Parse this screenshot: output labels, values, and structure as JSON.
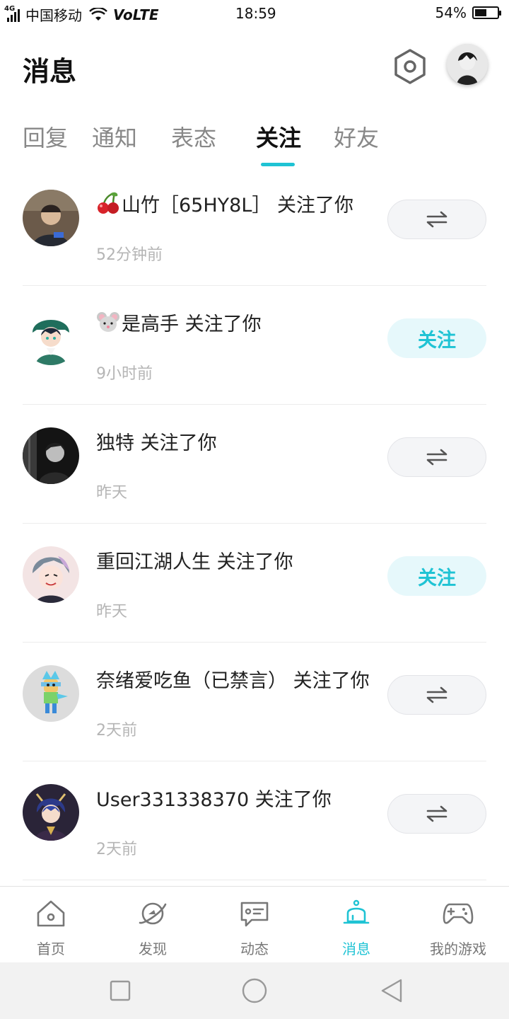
{
  "status_bar": {
    "network": "4G",
    "carrier": "中国移动",
    "volte": "VoLTE",
    "time": "18:59",
    "battery_text": "54%",
    "battery_level": 0.54
  },
  "header": {
    "title": "消息"
  },
  "tabs": [
    {
      "label": "回复",
      "active": false
    },
    {
      "label": "通知",
      "active": false
    },
    {
      "label": "表态",
      "active": false
    },
    {
      "label": "关注",
      "active": true
    },
    {
      "label": "好友",
      "active": false
    }
  ],
  "notifications": [
    {
      "emoji": "cherry-icon",
      "name": "山竹［65HY8L］ 关注了你",
      "time": "52分钟前",
      "action": "mutual",
      "action_label": ""
    },
    {
      "emoji": "mouse-icon",
      "name": "是高手 关注了你",
      "time": "9小时前",
      "action": "follow",
      "action_label": "关注"
    },
    {
      "emoji": "",
      "name": "独特 关注了你",
      "time": "昨天",
      "action": "mutual",
      "action_label": ""
    },
    {
      "emoji": "",
      "name": "重回江湖人生 关注了你",
      "time": "昨天",
      "action": "follow",
      "action_label": "关注"
    },
    {
      "emoji": "",
      "name": "奈绪爱吃鱼（已禁言） 关注了你",
      "time": "2天前",
      "action": "mutual",
      "action_label": ""
    },
    {
      "emoji": "",
      "name": "User331338370 关注了你",
      "time": "2天前",
      "action": "mutual",
      "action_label": ""
    }
  ],
  "bottom_nav": [
    {
      "label": "首页",
      "icon": "home-icon",
      "active": false
    },
    {
      "label": "发现",
      "icon": "planet-icon",
      "active": false
    },
    {
      "label": "动态",
      "icon": "chat-icon",
      "active": false
    },
    {
      "label": "消息",
      "icon": "bell-icon",
      "active": true
    },
    {
      "label": "我的游戏",
      "icon": "gamepad-icon",
      "active": false
    }
  ],
  "colors": {
    "accent": "#1fc3d4",
    "muted_text": "#b5b5b5",
    "follow_bg": "#e6f8fb"
  }
}
